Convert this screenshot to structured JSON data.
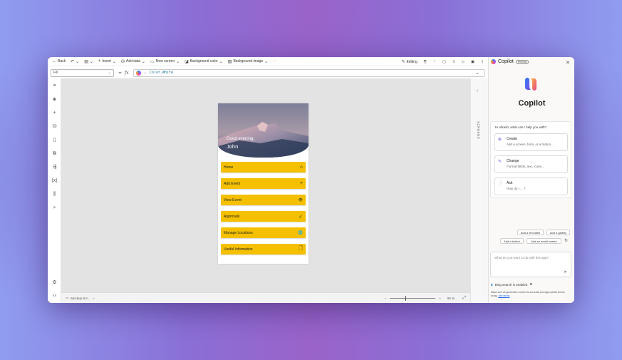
{
  "toolbar": {
    "back": "Back",
    "insert": "Insert",
    "add_data": "Add data",
    "new_screen": "New screen",
    "background_color": "Background color",
    "background_image": "Background image",
    "more": "···",
    "editing": "Editing"
  },
  "formula": {
    "property": "Fill",
    "fx": "fx",
    "value": "Color.White"
  },
  "app": {
    "greeting": "Good evening,",
    "user": "John",
    "menu": [
      {
        "label": "Home",
        "icon": "⌂"
      },
      {
        "label": "Add Event",
        "icon": "+"
      },
      {
        "label": "View Event",
        "icon": "👁"
      },
      {
        "label": "Approvals",
        "icon": "✓"
      },
      {
        "label": "Manage Locations",
        "icon": "🌐"
      },
      {
        "label": "Useful Information",
        "icon": "🗋"
      }
    ]
  },
  "bottombar": {
    "screen": "Mockup Scr...",
    "zoom": "55 %",
    "minus": "−",
    "plus": "+"
  },
  "tree_strip": {
    "label": "SCREENS"
  },
  "copilot": {
    "header": "Copilot",
    "badge": "Preview",
    "title": "Copilot",
    "hi": "Hi Vikash, what can I help you with?",
    "options": [
      {
        "title": "Create",
        "desc": "Add a screen, form, or a button...",
        "icon": "⊕"
      },
      {
        "title": "Change",
        "desc": "Format fields, text, icons...",
        "icon": "✎"
      },
      {
        "title": "Ask",
        "desc": "How do I ... ?",
        "icon": "❔"
      }
    ],
    "chips": [
      "Add a text label",
      "Add a gallery",
      "Add a button",
      "Add an email screen"
    ],
    "placeholder": "What do you want to do with this app?",
    "bing": "Bing search is enabled",
    "disclaimer": "Make sure AI-generated content is accurate and appropriate before using.",
    "see_terms": "See terms"
  },
  "colors": {
    "accent_yellow": "#f4c000",
    "copilot_purple": "#6b4bd6"
  }
}
